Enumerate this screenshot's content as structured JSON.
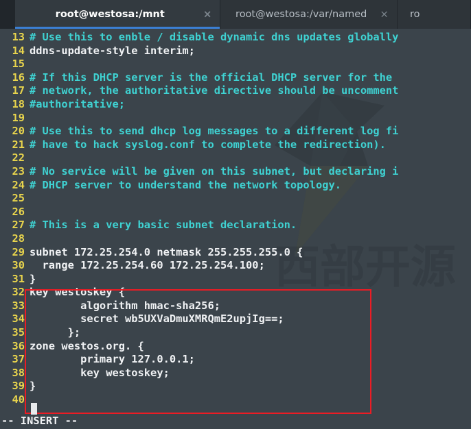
{
  "window": {
    "tabs": [
      {
        "title": "root@westosa:/mnt",
        "close_icon": "×",
        "active": true
      },
      {
        "title": "root@westosa:/var/named",
        "close_icon": "×",
        "active": false
      },
      {
        "title": "ro",
        "close_icon": "",
        "active": false
      }
    ]
  },
  "editor": {
    "mode_status": "-- INSERT --",
    "cursor_line": 40,
    "colors": {
      "background": "#3b444b",
      "line_number": "#e8d44d",
      "comment": "#3fd2d2",
      "code_text": "#f0f2f4",
      "tab_active_underline": "#3b7fd4",
      "annotation_box": "#ec1c24"
    },
    "lines": [
      {
        "n": "13",
        "text": "# Use this to enble / disable dynamic dns updates globally",
        "kind": "comment"
      },
      {
        "n": "14",
        "text": "ddns-update-style interim;",
        "kind": "code"
      },
      {
        "n": "15",
        "text": "",
        "kind": "code"
      },
      {
        "n": "16",
        "text": "# If this DHCP server is the official DHCP server for the",
        "kind": "comment"
      },
      {
        "n": "17",
        "text": "# network, the authoritative directive should be uncomment",
        "kind": "comment"
      },
      {
        "n": "18",
        "text": "#authoritative;",
        "kind": "comment"
      },
      {
        "n": "19",
        "text": "",
        "kind": "code"
      },
      {
        "n": "20",
        "text": "# Use this to send dhcp log messages to a different log fi",
        "kind": "comment"
      },
      {
        "n": "21",
        "text": "# have to hack syslog.conf to complete the redirection).",
        "kind": "comment"
      },
      {
        "n": "22",
        "text": "",
        "kind": "code"
      },
      {
        "n": "23",
        "text": "# No service will be given on this subnet, but declaring i",
        "kind": "comment"
      },
      {
        "n": "24",
        "text": "# DHCP server to understand the network topology.",
        "kind": "comment"
      },
      {
        "n": "25",
        "text": "",
        "kind": "code"
      },
      {
        "n": "26",
        "text": "",
        "kind": "code"
      },
      {
        "n": "27",
        "text": "# This is a very basic subnet declaration.",
        "kind": "comment"
      },
      {
        "n": "28",
        "text": "",
        "kind": "code"
      },
      {
        "n": "29",
        "text": "subnet 172.25.254.0 netmask 255.255.255.0 {",
        "kind": "code"
      },
      {
        "n": "30",
        "text": "  range 172.25.254.60 172.25.254.100;",
        "kind": "code"
      },
      {
        "n": "31",
        "text": "}",
        "kind": "code"
      },
      {
        "n": "32",
        "text": "key westoskey {",
        "kind": "code"
      },
      {
        "n": "33",
        "text": "        algorithm hmac-sha256;",
        "kind": "code"
      },
      {
        "n": "34",
        "text": "        secret wb5UXVaDmuXMRQmE2upjIg==;",
        "kind": "code"
      },
      {
        "n": "35",
        "text": "      };",
        "kind": "code"
      },
      {
        "n": "36",
        "text": "zone westos.org. {",
        "kind": "code"
      },
      {
        "n": "37",
        "text": "        primary 127.0.0.1;",
        "kind": "code"
      },
      {
        "n": "38",
        "text": "        key westoskey;",
        "kind": "code"
      },
      {
        "n": "39",
        "text": "}",
        "kind": "code"
      },
      {
        "n": "40",
        "text": "",
        "kind": "code"
      }
    ]
  },
  "watermark": {
    "text": "西部开源",
    "logo_icon": "arrow-chevron-logo"
  }
}
